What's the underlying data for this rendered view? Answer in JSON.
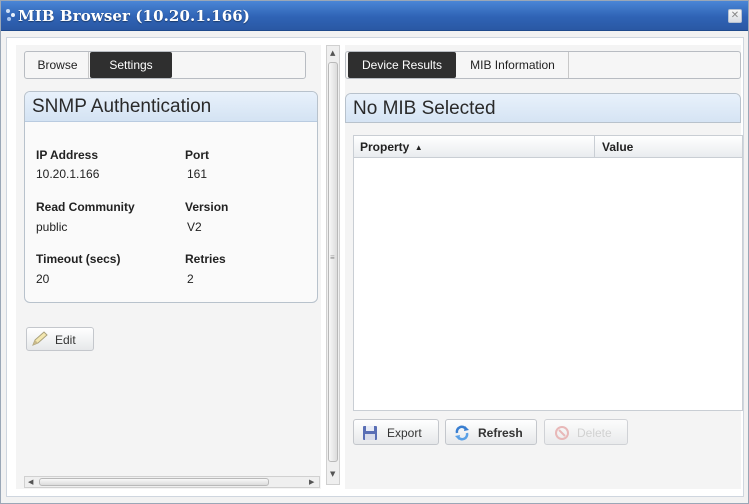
{
  "window": {
    "title": "MIB Browser (10.20.1.166)",
    "close_glyph": "✕"
  },
  "left_tabs": [
    {
      "label": "Browse",
      "active": false
    },
    {
      "label": "Settings",
      "active": true
    }
  ],
  "snmp_panel": {
    "title": "SNMP Authentication",
    "fields": [
      {
        "label": "IP Address",
        "value": "10.20.1.166"
      },
      {
        "label": "Port",
        "value": "161"
      },
      {
        "label": "Read Community",
        "value": "public"
      },
      {
        "label": "Version",
        "value": "V2"
      },
      {
        "label": "Timeout (secs)",
        "value": "20"
      },
      {
        "label": "Retries",
        "value": "2"
      }
    ]
  },
  "edit_button": {
    "label": "Edit",
    "icon": "pencil-icon"
  },
  "right_tabs": [
    {
      "label": "Device Results",
      "active": true
    },
    {
      "label": "MIB Information",
      "active": false
    }
  ],
  "mib_panel": {
    "title": "No MIB Selected"
  },
  "table": {
    "columns": [
      {
        "label": "Property",
        "sort": "ascending"
      },
      {
        "label": "Value"
      }
    ],
    "rows": []
  },
  "actions": [
    {
      "label": "Export",
      "icon": "floppy-disk-icon",
      "enabled": true
    },
    {
      "label": "Refresh",
      "icon": "refresh-icon",
      "enabled": true
    },
    {
      "label": "Delete",
      "icon": "delete-icon",
      "enabled": false
    }
  ],
  "colors": {
    "titlebar": "#2f63b5",
    "active_tab": "#2f2f2f",
    "panel_header": "#d4e3f3"
  }
}
